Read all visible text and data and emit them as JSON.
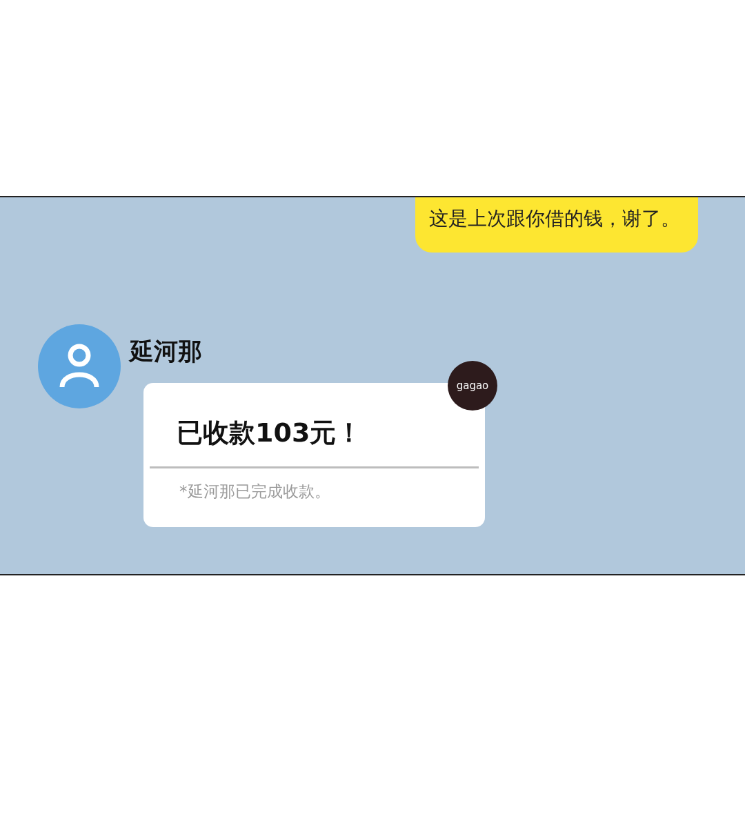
{
  "outgoing_message": {
    "text": "这是上次跟你借的钱，谢了。"
  },
  "incoming": {
    "sender": "延河那",
    "badge": "gagao",
    "card": {
      "title": "已收款103元！",
      "note": "*延河那已完成收款。"
    }
  }
}
